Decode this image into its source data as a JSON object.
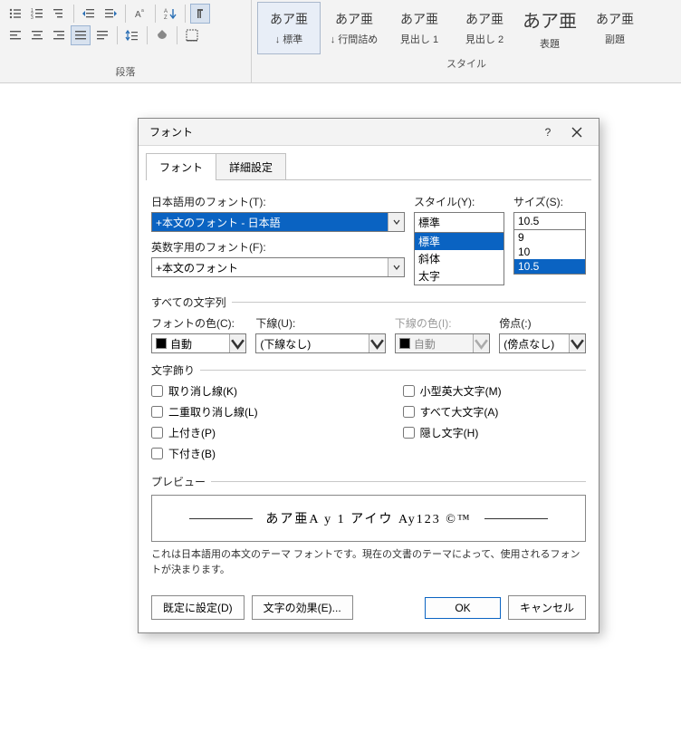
{
  "ribbon": {
    "paragraph_label": "段落",
    "styles_label": "スタイル",
    "styles": [
      {
        "sample": "あア亜",
        "label": "↓ 標準"
      },
      {
        "sample": "あア亜",
        "label": "↓ 行間詰め"
      },
      {
        "sample": "あア亜",
        "label": "見出し 1"
      },
      {
        "sample": "あア亜",
        "label": "見出し 2"
      },
      {
        "sample": "あア亜",
        "label": "表題"
      },
      {
        "sample": "あア亜",
        "label": "副題"
      }
    ]
  },
  "dialog": {
    "title": "フォント",
    "tabs": {
      "font": "フォント",
      "advanced": "詳細設定"
    },
    "labels": {
      "jp_font": "日本語用のフォント(T):",
      "ascii_font": "英数字用のフォント(F):",
      "style": "スタイル(Y):",
      "size": "サイズ(S):",
      "all_chars": "すべての文字列",
      "font_color": "フォントの色(C):",
      "underline": "下線(U):",
      "underline_color": "下線の色(I):",
      "emphasis": "傍点(:)",
      "decorations": "文字飾り",
      "preview": "プレビュー"
    },
    "jp_font_value": "+本文のフォント - 日本語",
    "ascii_font_value": "+本文のフォント",
    "style_value": "標準",
    "style_options": [
      "標準",
      "斜体",
      "太字"
    ],
    "size_value": "10.5",
    "size_options": [
      "9",
      "10",
      "10.5"
    ],
    "font_color_value": "自動",
    "underline_value": "(下線なし)",
    "underline_color_value": "自動",
    "emphasis_value": "(傍点なし)",
    "checks": {
      "strike": "取り消し線(K)",
      "dstrike": "二重取り消し線(L)",
      "super": "上付き(P)",
      "sub": "下付き(B)",
      "smallcaps": "小型英大文字(M)",
      "allcaps": "すべて大文字(A)",
      "hidden": "隠し文字(H)"
    },
    "preview_text": "あア亜A y 1 アイウ Ay123 ©™",
    "note": "これは日本語用の本文のテーマ フォントです。現在の文書のテーマによって、使用されるフォントが決まります。",
    "buttons": {
      "default": "既定に設定(D)",
      "effects": "文字の効果(E)...",
      "ok": "OK",
      "cancel": "キャンセル"
    }
  }
}
